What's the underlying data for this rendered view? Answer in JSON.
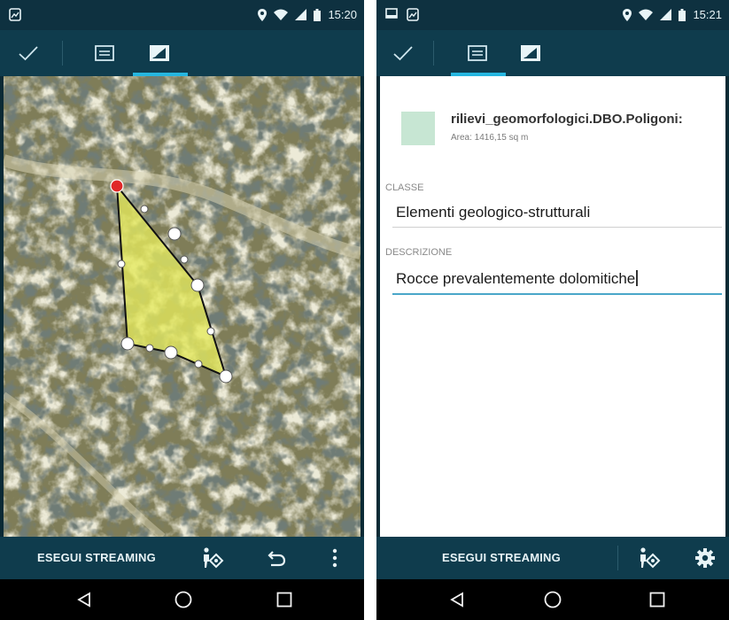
{
  "left": {
    "status_time": "15:20",
    "bottom_bar": {
      "stream_label": "ESEGUI STREAMING"
    }
  },
  "right": {
    "status_time": "15:21",
    "layer": {
      "name": "rilievi_geomorfologici.DBO.Poligoni:",
      "area": "Area: 1416,15 sq m"
    },
    "fields": [
      {
        "label": "CLASSE",
        "value": "Elementi geologico-strutturali"
      },
      {
        "label": "DESCRIZIONE",
        "value": "Rocce prevalentemente dolomitiche"
      }
    ],
    "bottom_bar": {
      "stream_label": "ESEGUI STREAMING"
    }
  },
  "colors": {
    "bar": "#0f3c4d",
    "status_bar": "#0e3140",
    "tab_indicator": "#26b6e0",
    "polygon_fill": "#e6ea5c",
    "selected_vertex": "#e02828",
    "swatch": "#c7e6d3"
  },
  "icons": {
    "status_left": [
      "image-icon"
    ],
    "status_right": [
      "location-pin-icon",
      "wifi-icon",
      "signal-icon",
      "battery-icon"
    ],
    "action_bar": [
      "check-icon",
      "attributes-tab-icon",
      "geometry-tab-icon"
    ],
    "bottom_left": [
      "gps-locate-icon",
      "undo-icon",
      "overflow-menu-icon"
    ],
    "bottom_right": [
      "gps-locate-icon",
      "settings-gear-icon"
    ],
    "navigation": [
      "back-icon",
      "home-icon",
      "recents-icon"
    ]
  }
}
